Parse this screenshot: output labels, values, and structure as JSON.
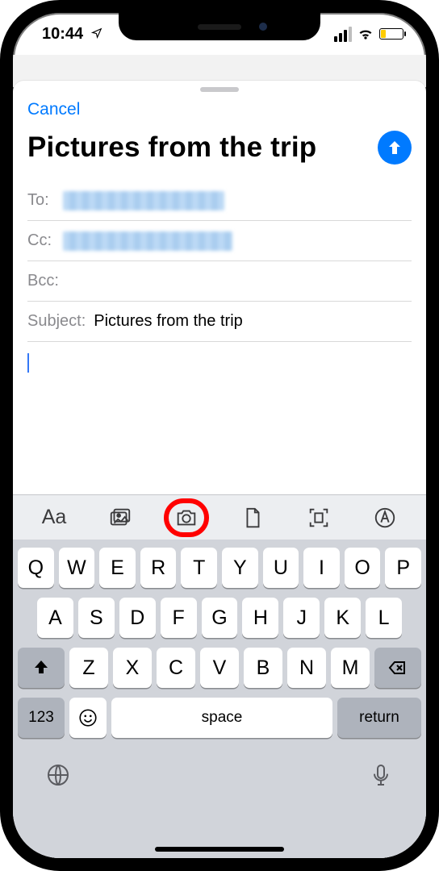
{
  "status": {
    "time": "10:44",
    "location_arrow": "➤",
    "battery_low": true
  },
  "compose": {
    "cancel": "Cancel",
    "title": "Pictures from the trip",
    "fields": {
      "to_label": "To:",
      "cc_label": "Cc:",
      "bcc_label": "Bcc:",
      "subject_label": "Subject:",
      "subject_value": "Pictures from the trip"
    }
  },
  "toolbar": {
    "format": "Aa"
  },
  "keyboard": {
    "rows": {
      "r1": [
        "Q",
        "W",
        "E",
        "R",
        "T",
        "Y",
        "U",
        "I",
        "O",
        "P"
      ],
      "r2": [
        "A",
        "S",
        "D",
        "F",
        "G",
        "H",
        "J",
        "K",
        "L"
      ],
      "r3": [
        "Z",
        "X",
        "C",
        "V",
        "B",
        "N",
        "M"
      ]
    },
    "num": "123",
    "emoji": "☺",
    "space": "space",
    "return": "return"
  },
  "annotation": {
    "highlighted_tool": "camera"
  }
}
